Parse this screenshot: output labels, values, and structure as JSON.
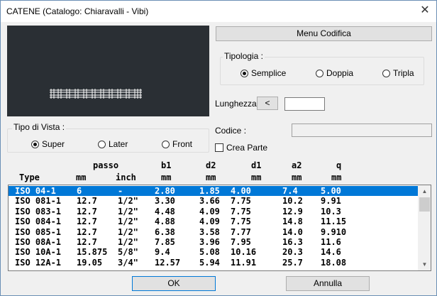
{
  "window": {
    "title": "CATENE (Catalogo: Chiaravalli - Vibi)",
    "close_glyph": "✕"
  },
  "buttons": {
    "menu_codifica": "Menu Codifica",
    "lunghezza_prev": "<",
    "ok": "OK",
    "annulla": "Annulla"
  },
  "tipologia": {
    "title": "Tipologia :",
    "options": [
      "Semplice",
      "Doppia",
      "Tripla"
    ],
    "selected": "Semplice"
  },
  "lunghezza": {
    "label": "Lunghezza",
    "value": ""
  },
  "tipo_vista": {
    "title": "Tipo di Vista :",
    "options": [
      "Super",
      "Later",
      "Front"
    ],
    "selected": "Super"
  },
  "codice": {
    "label": "Codice :",
    "value": ""
  },
  "crea_parte": {
    "label": "Crea Parte",
    "checked": false
  },
  "table": {
    "header_top": [
      "",
      "passo",
      "",
      "b1",
      "d2",
      "d1",
      "a2",
      "q"
    ],
    "header_bottom": [
      "Type",
      "mm",
      "inch",
      "mm",
      "mm",
      "mm",
      "mm",
      "mm"
    ],
    "rows": [
      [
        "ISO 04-1",
        "6",
        "-",
        "2.80",
        "1.85",
        "4.00",
        "7.4",
        "5.00"
      ],
      [
        "ISO 081-1",
        "12.7",
        "1/2\"",
        "3.30",
        "3.66",
        "7.75",
        "10.2",
        "9.91"
      ],
      [
        "ISO 083-1",
        "12.7",
        "1/2\"",
        "4.48",
        "4.09",
        "7.75",
        "12.9",
        "10.3"
      ],
      [
        "ISO 084-1",
        "12.7",
        "1/2\"",
        "4.88",
        "4.09",
        "7.75",
        "14.8",
        "11.15"
      ],
      [
        "ISO 085-1",
        "12.7",
        "1/2\"",
        "6.38",
        "3.58",
        "7.77",
        "14.0",
        "9.910"
      ],
      [
        "ISO 08A-1",
        "12.7",
        "1/2\"",
        "7.85",
        "3.96",
        "7.95",
        "16.3",
        "11.6"
      ],
      [
        "ISO 10A-1",
        "15.875",
        "5/8\"",
        "9.4",
        "5.08",
        "10.16",
        "20.3",
        "14.6"
      ],
      [
        "ISO 12A-1",
        "19.05",
        "3/4\"",
        "12.57",
        "5.94",
        "11.91",
        "25.7",
        "18.08"
      ]
    ],
    "selected_row": 0
  },
  "colors": {
    "selection": "#0078d7",
    "preview_bg": "#2a2f34",
    "chain_stroke": "#ffffff"
  }
}
